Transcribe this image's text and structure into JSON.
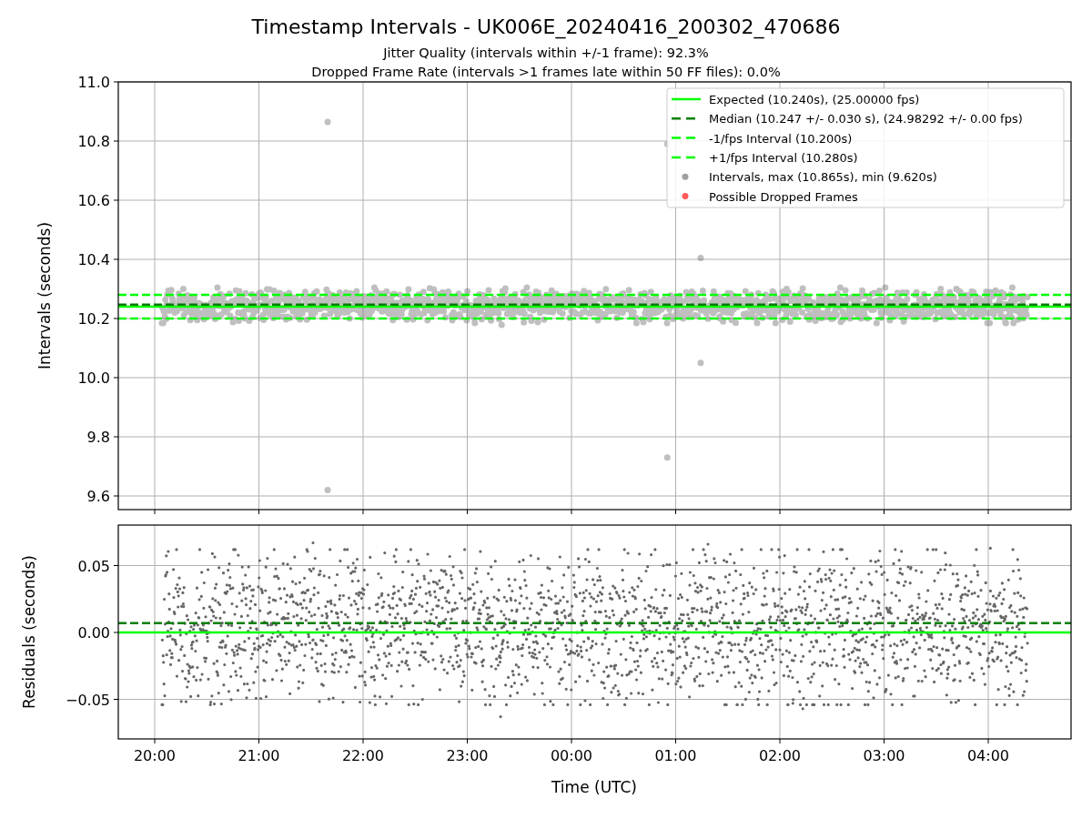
{
  "figure": {
    "title": "Timestamp Intervals - UK006E_20240416_200302_470686",
    "subtitles": [
      "Jitter Quality (intervals within +/-1 frame): 92.3%",
      "Dropped Frame Rate (intervals >1 frames late within 50 FF files): 0.0%"
    ]
  },
  "intervals_panel": {
    "y_axis_label": "Intervals (seconds)",
    "y_tick_labels": [
      "11.0",
      "10.8",
      "10.6",
      "10.4",
      "10.2",
      "10.0",
      "9.8",
      "9.6"
    ],
    "legend": [
      {
        "label": "Expected (10.240s), (25.00000 fps)",
        "kind": "solid",
        "color": "#00ff00"
      },
      {
        "label": "Median (10.247 +/- 0.030 s), (24.98292 +/- 0.00 fps)",
        "kind": "dashed",
        "color": "#007f00"
      },
      {
        "label": "-1/fps Interval (10.200s)",
        "kind": "dashed",
        "color": "#00ff00"
      },
      {
        "label": "+1/fps Interval (10.280s)",
        "kind": "dashed",
        "color": "#00ff00"
      },
      {
        "label": "Intervals, max (10.865s), min (9.620s)",
        "kind": "dot",
        "color": "#a0a0a0"
      },
      {
        "label": "Possible Dropped Frames",
        "kind": "dot",
        "color": "#ff5a5a"
      }
    ]
  },
  "residuals_panel": {
    "y_axis_label": "Residuals (seconds)",
    "y_tick_labels": [
      "0.05",
      "0.00",
      "−0.05"
    ],
    "x_tick_labels": [
      "20:00",
      "21:00",
      "22:00",
      "23:00",
      "00:00",
      "01:00",
      "02:00",
      "03:00",
      "04:00"
    ],
    "x_axis_label": "Time (UTC)"
  }
}
